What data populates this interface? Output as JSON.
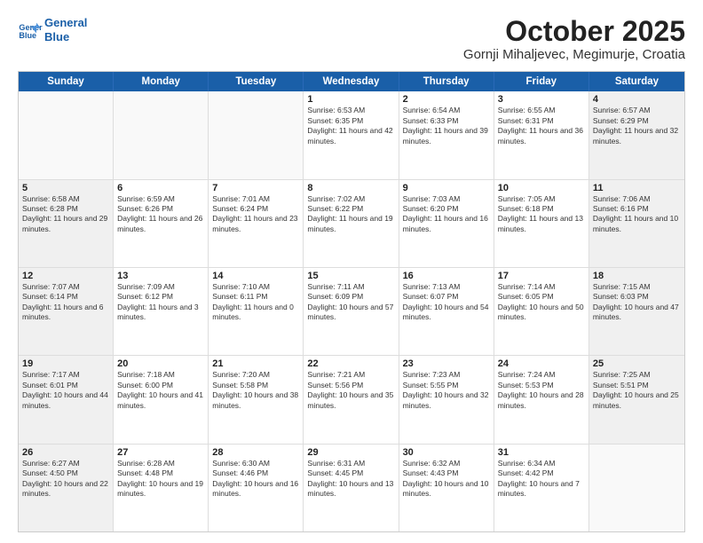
{
  "header": {
    "logo_line1": "General",
    "logo_line2": "Blue",
    "title": "October 2025",
    "subtitle": "Gornji Mihaljevec, Megimurje, Croatia"
  },
  "days_of_week": [
    "Sunday",
    "Monday",
    "Tuesday",
    "Wednesday",
    "Thursday",
    "Friday",
    "Saturday"
  ],
  "weeks": [
    [
      {
        "day": "",
        "info": ""
      },
      {
        "day": "",
        "info": ""
      },
      {
        "day": "",
        "info": ""
      },
      {
        "day": "1",
        "info": "Sunrise: 6:53 AM\nSunset: 6:35 PM\nDaylight: 11 hours and 42 minutes."
      },
      {
        "day": "2",
        "info": "Sunrise: 6:54 AM\nSunset: 6:33 PM\nDaylight: 11 hours and 39 minutes."
      },
      {
        "day": "3",
        "info": "Sunrise: 6:55 AM\nSunset: 6:31 PM\nDaylight: 11 hours and 36 minutes."
      },
      {
        "day": "4",
        "info": "Sunrise: 6:57 AM\nSunset: 6:29 PM\nDaylight: 11 hours and 32 minutes."
      }
    ],
    [
      {
        "day": "5",
        "info": "Sunrise: 6:58 AM\nSunset: 6:28 PM\nDaylight: 11 hours and 29 minutes."
      },
      {
        "day": "6",
        "info": "Sunrise: 6:59 AM\nSunset: 6:26 PM\nDaylight: 11 hours and 26 minutes."
      },
      {
        "day": "7",
        "info": "Sunrise: 7:01 AM\nSunset: 6:24 PM\nDaylight: 11 hours and 23 minutes."
      },
      {
        "day": "8",
        "info": "Sunrise: 7:02 AM\nSunset: 6:22 PM\nDaylight: 11 hours and 19 minutes."
      },
      {
        "day": "9",
        "info": "Sunrise: 7:03 AM\nSunset: 6:20 PM\nDaylight: 11 hours and 16 minutes."
      },
      {
        "day": "10",
        "info": "Sunrise: 7:05 AM\nSunset: 6:18 PM\nDaylight: 11 hours and 13 minutes."
      },
      {
        "day": "11",
        "info": "Sunrise: 7:06 AM\nSunset: 6:16 PM\nDaylight: 11 hours and 10 minutes."
      }
    ],
    [
      {
        "day": "12",
        "info": "Sunrise: 7:07 AM\nSunset: 6:14 PM\nDaylight: 11 hours and 6 minutes."
      },
      {
        "day": "13",
        "info": "Sunrise: 7:09 AM\nSunset: 6:12 PM\nDaylight: 11 hours and 3 minutes."
      },
      {
        "day": "14",
        "info": "Sunrise: 7:10 AM\nSunset: 6:11 PM\nDaylight: 11 hours and 0 minutes."
      },
      {
        "day": "15",
        "info": "Sunrise: 7:11 AM\nSunset: 6:09 PM\nDaylight: 10 hours and 57 minutes."
      },
      {
        "day": "16",
        "info": "Sunrise: 7:13 AM\nSunset: 6:07 PM\nDaylight: 10 hours and 54 minutes."
      },
      {
        "day": "17",
        "info": "Sunrise: 7:14 AM\nSunset: 6:05 PM\nDaylight: 10 hours and 50 minutes."
      },
      {
        "day": "18",
        "info": "Sunrise: 7:15 AM\nSunset: 6:03 PM\nDaylight: 10 hours and 47 minutes."
      }
    ],
    [
      {
        "day": "19",
        "info": "Sunrise: 7:17 AM\nSunset: 6:01 PM\nDaylight: 10 hours and 44 minutes."
      },
      {
        "day": "20",
        "info": "Sunrise: 7:18 AM\nSunset: 6:00 PM\nDaylight: 10 hours and 41 minutes."
      },
      {
        "day": "21",
        "info": "Sunrise: 7:20 AM\nSunset: 5:58 PM\nDaylight: 10 hours and 38 minutes."
      },
      {
        "day": "22",
        "info": "Sunrise: 7:21 AM\nSunset: 5:56 PM\nDaylight: 10 hours and 35 minutes."
      },
      {
        "day": "23",
        "info": "Sunrise: 7:23 AM\nSunset: 5:55 PM\nDaylight: 10 hours and 32 minutes."
      },
      {
        "day": "24",
        "info": "Sunrise: 7:24 AM\nSunset: 5:53 PM\nDaylight: 10 hours and 28 minutes."
      },
      {
        "day": "25",
        "info": "Sunrise: 7:25 AM\nSunset: 5:51 PM\nDaylight: 10 hours and 25 minutes."
      }
    ],
    [
      {
        "day": "26",
        "info": "Sunrise: 6:27 AM\nSunset: 4:50 PM\nDaylight: 10 hours and 22 minutes."
      },
      {
        "day": "27",
        "info": "Sunrise: 6:28 AM\nSunset: 4:48 PM\nDaylight: 10 hours and 19 minutes."
      },
      {
        "day": "28",
        "info": "Sunrise: 6:30 AM\nSunset: 4:46 PM\nDaylight: 10 hours and 16 minutes."
      },
      {
        "day": "29",
        "info": "Sunrise: 6:31 AM\nSunset: 4:45 PM\nDaylight: 10 hours and 13 minutes."
      },
      {
        "day": "30",
        "info": "Sunrise: 6:32 AM\nSunset: 4:43 PM\nDaylight: 10 hours and 10 minutes."
      },
      {
        "day": "31",
        "info": "Sunrise: 6:34 AM\nSunset: 4:42 PM\nDaylight: 10 hours and 7 minutes."
      },
      {
        "day": "",
        "info": ""
      }
    ]
  ]
}
